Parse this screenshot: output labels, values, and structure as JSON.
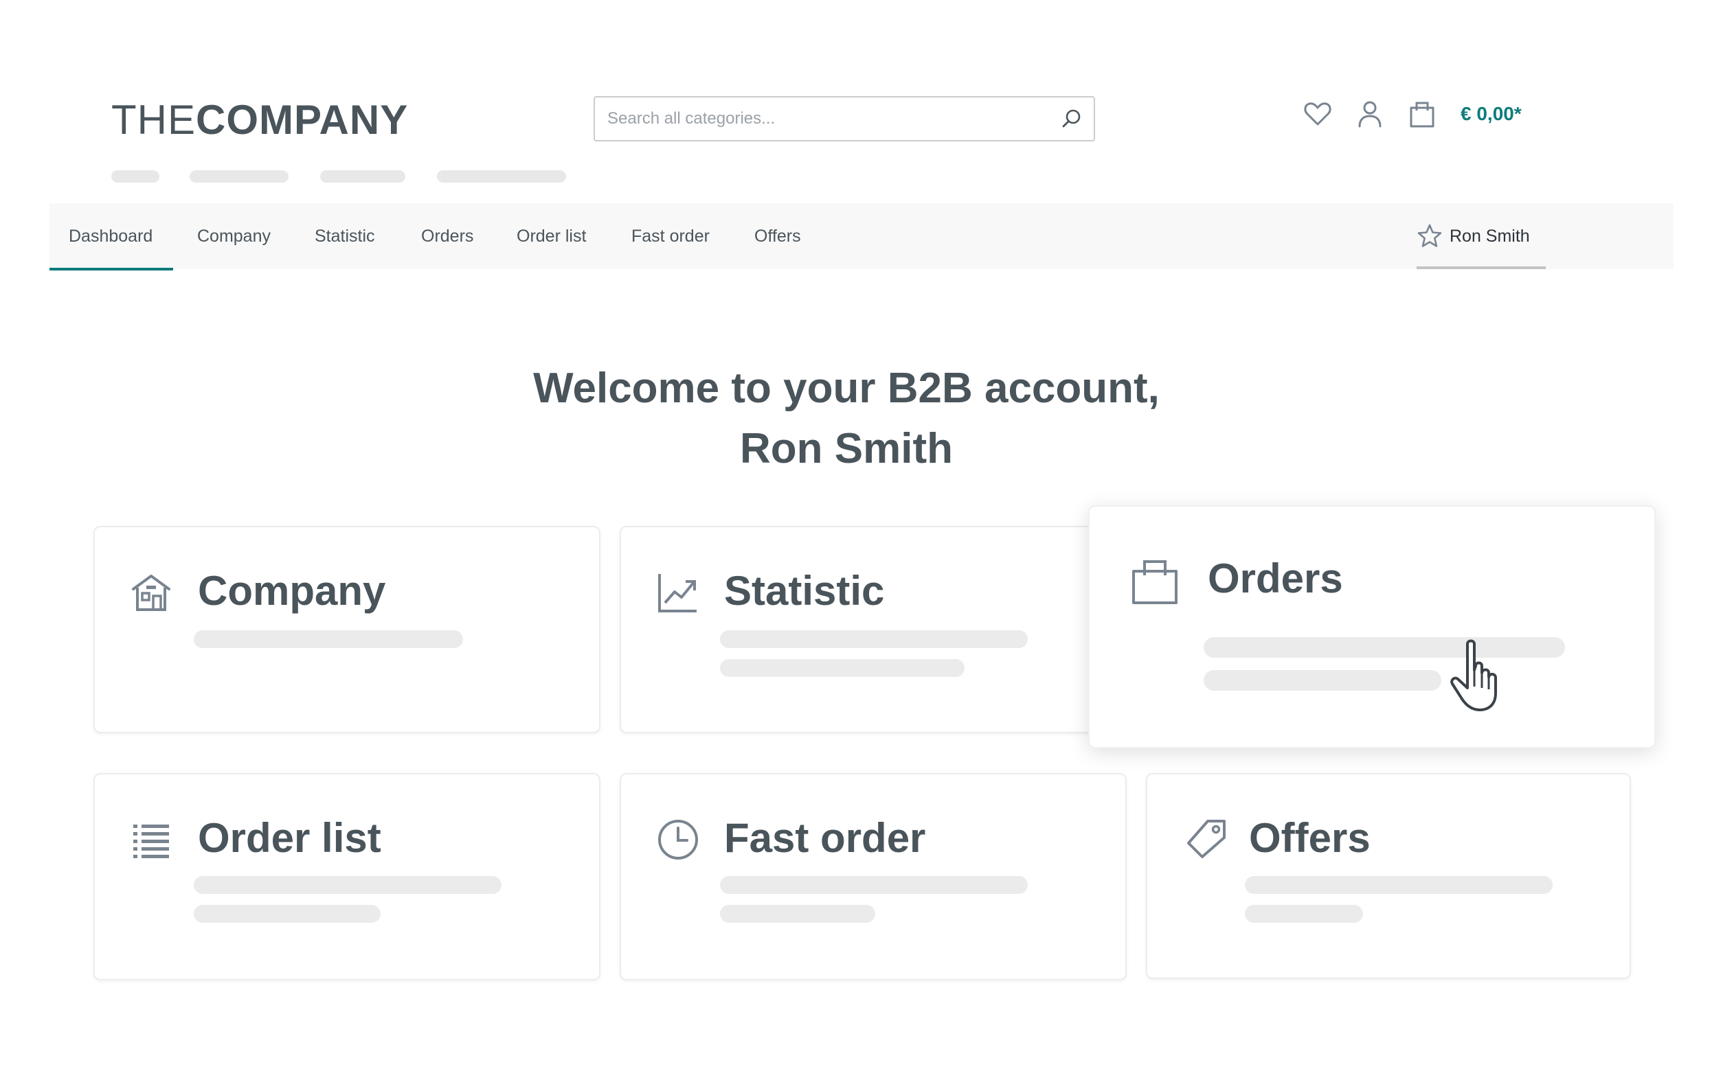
{
  "header": {
    "logo_light": "THE",
    "logo_bold": "COMPANY",
    "search_placeholder": "Search all categories...",
    "cart_total": "€ 0,00*"
  },
  "nav": {
    "items": [
      {
        "label": "Dashboard",
        "active": true
      },
      {
        "label": "Company"
      },
      {
        "label": "Statistic"
      },
      {
        "label": "Orders"
      },
      {
        "label": "Order list"
      },
      {
        "label": "Fast order"
      },
      {
        "label": "Offers"
      }
    ],
    "user": "Ron Smith"
  },
  "welcome": {
    "line1": "Welcome to your B2B account,",
    "line2": "Ron Smith"
  },
  "cards": [
    {
      "title": "Company",
      "icon": "building-icon"
    },
    {
      "title": "Statistic",
      "icon": "chart-trend-icon"
    },
    {
      "title": "Orders",
      "icon": "shopping-bag-icon"
    },
    {
      "title": "Order list",
      "icon": "list-icon"
    },
    {
      "title": "Fast order",
      "icon": "clock-icon"
    },
    {
      "title": "Offers",
      "icon": "tag-icon"
    }
  ],
  "colors": {
    "accent": "#0e7c7b",
    "text": "#4a545b",
    "icon": "#798490"
  }
}
